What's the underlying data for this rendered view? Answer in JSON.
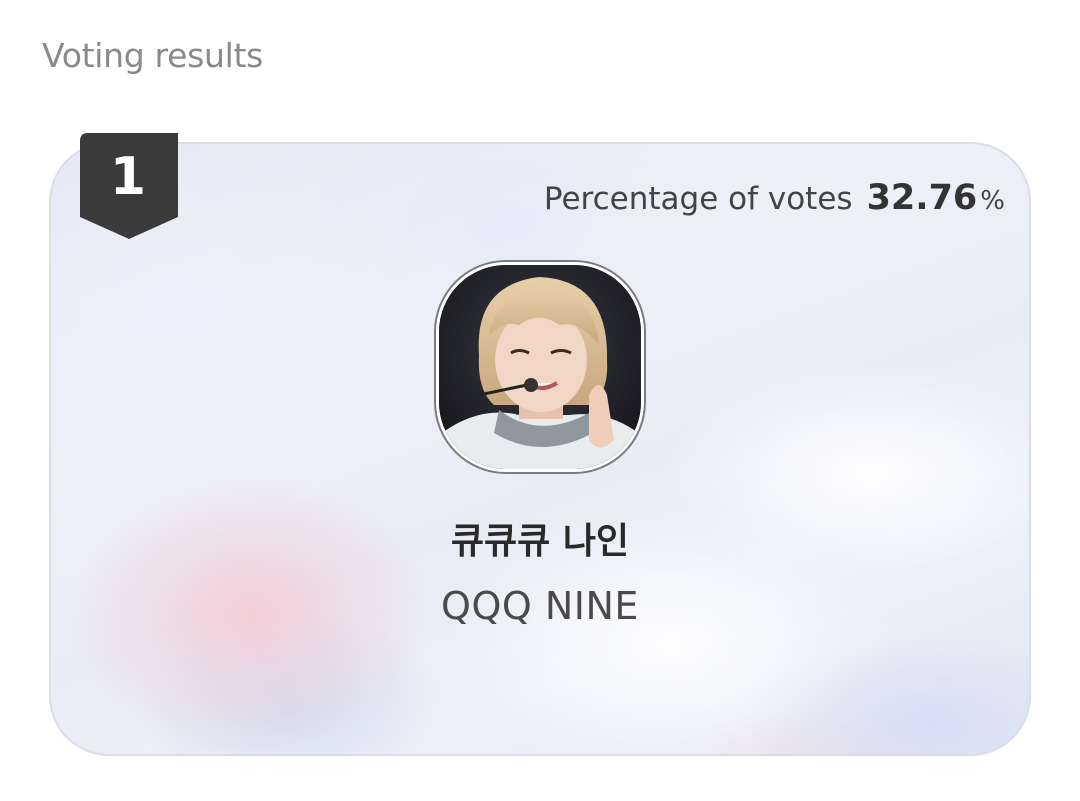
{
  "section": {
    "title": "Voting results"
  },
  "result": {
    "rank": "1",
    "percentage_label": "Percentage of votes",
    "percentage_value": "32.76",
    "percentage_unit": "%",
    "name_korean": "큐큐큐 나인",
    "name_english": "QQQ NINE"
  },
  "colors": {
    "badge": "#3a3a3a",
    "title_gray": "#8a8a8a",
    "text_dark": "#333333"
  }
}
